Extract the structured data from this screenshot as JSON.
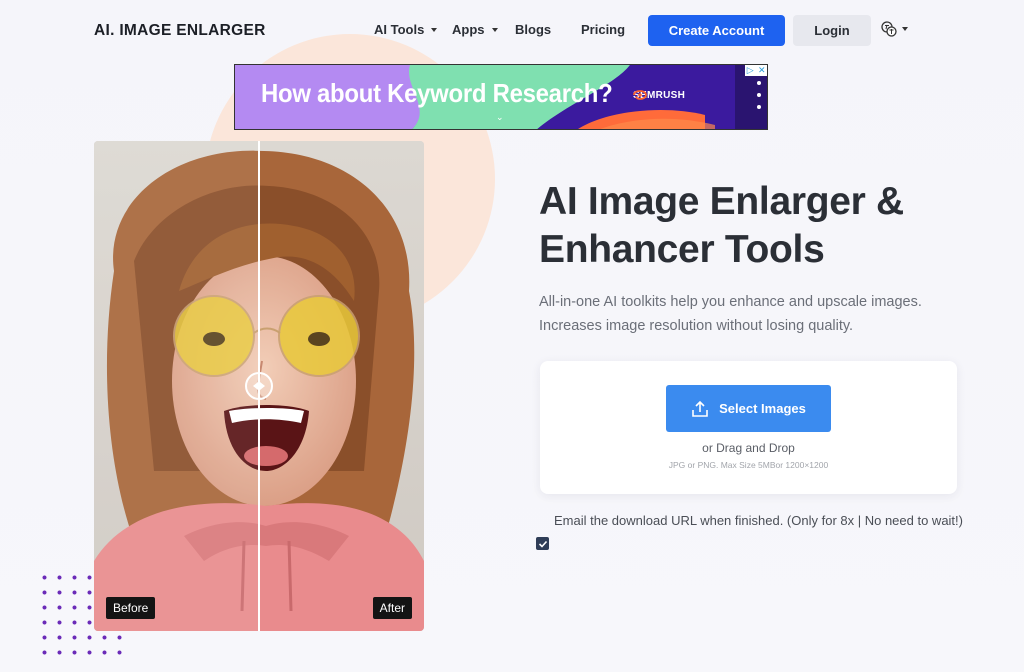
{
  "nav": {
    "logo": "AI. IMAGE ENLARGER",
    "links": [
      "AI Tools",
      "Apps",
      "Blogs",
      "Pricing"
    ],
    "create_account": "Create Account",
    "login": "Login",
    "language_icon": "translate-icon"
  },
  "ad": {
    "headline": "How about Keyword Research?",
    "brand": "SEMRUSH"
  },
  "compare": {
    "before_label": "Before",
    "after_label": "After"
  },
  "hero": {
    "title_line1": "AI Image Enlarger &",
    "title_line2": "Enhancer Tools",
    "subtitle_line1": "All-in-one AI toolkits help you enhance and upscale images.",
    "subtitle_line2": "Increases image resolution without losing quality."
  },
  "upload": {
    "select_label": "Select Images",
    "drag_label": "or Drag and Drop",
    "limits": "JPG or PNG. Max Size 5MBor 1200×1200"
  },
  "email_option": {
    "text": "Email the download URL when finished. (Only for 8x | No need to wait!)",
    "checked": true
  },
  "colors": {
    "primary": "#1e62f0",
    "select_button": "#3b8bef",
    "peach": "#fbe6da",
    "dots": "#6b2bb8"
  }
}
